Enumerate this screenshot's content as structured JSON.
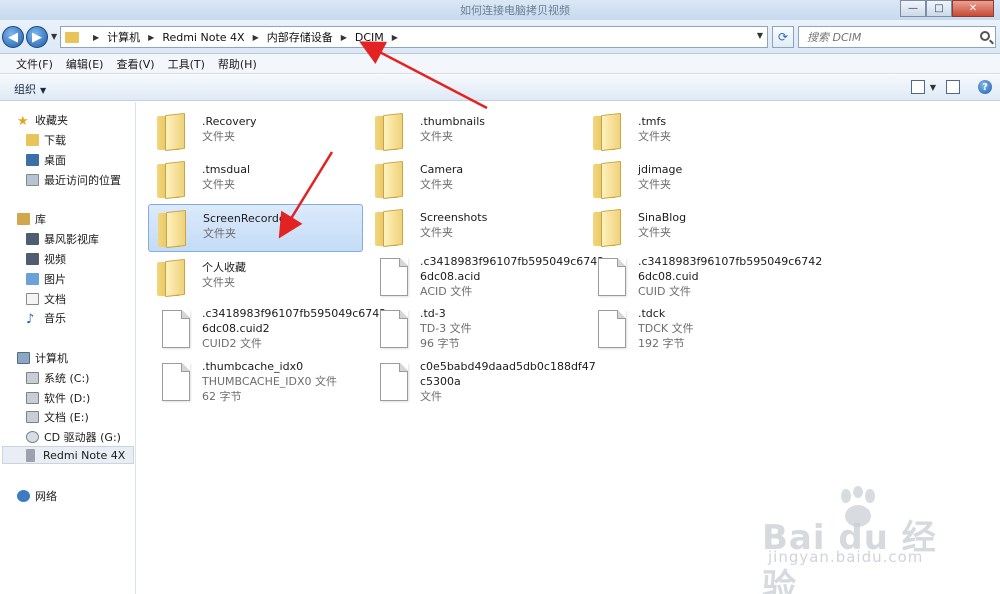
{
  "window": {
    "title": "如何连接电脑拷贝视频",
    "buttons": {
      "minimize": "—",
      "maximize": "□",
      "close": "✕"
    }
  },
  "address": {
    "crumbs": [
      "计算机",
      "Redmi Note 4X",
      "内部存储设备",
      "DCIM"
    ],
    "search_placeholder": "搜索 DCIM"
  },
  "menu": [
    "文件(F)",
    "编辑(E)",
    "查看(V)",
    "工具(T)",
    "帮助(H)"
  ],
  "toolbar": {
    "organize": "组织"
  },
  "sidebar": {
    "favorites": {
      "label": "收藏夹",
      "items": [
        "下载",
        "桌面",
        "最近访问的位置"
      ]
    },
    "libraries": {
      "label": "库",
      "items": [
        "暴风影视库",
        "视频",
        "图片",
        "文档",
        "音乐"
      ]
    },
    "computer": {
      "label": "计算机",
      "items": [
        "系统 (C:)",
        "软件 (D:)",
        "文档 (E:)",
        "CD 驱动器 (G:)",
        "Redmi Note 4X"
      ],
      "selected": "Redmi Note 4X"
    },
    "network": {
      "label": "网络"
    }
  },
  "files": [
    {
      "name": ".Recovery",
      "type": "文件夹",
      "kind": "folder"
    },
    {
      "name": ".thumbnails",
      "type": "文件夹",
      "kind": "folder"
    },
    {
      "name": ".tmfs",
      "type": "文件夹",
      "kind": "folder"
    },
    {
      "name": ".tmsdual",
      "type": "文件夹",
      "kind": "folder"
    },
    {
      "name": "Camera",
      "type": "文件夹",
      "kind": "folder"
    },
    {
      "name": "jdimage",
      "type": "文件夹",
      "kind": "folder"
    },
    {
      "name": "ScreenRecorder",
      "type": "文件夹",
      "kind": "folder",
      "selected": true
    },
    {
      "name": "Screenshots",
      "type": "文件夹",
      "kind": "folder"
    },
    {
      "name": "SinaBlog",
      "type": "文件夹",
      "kind": "folder"
    },
    {
      "name": "个人收藏",
      "type": "文件夹",
      "kind": "folder"
    },
    {
      "name": ".c3418983f96107fb595049c6742\n6dc08.acid",
      "type": "ACID 文件",
      "kind": "file"
    },
    {
      "name": ".c3418983f96107fb595049c6742\n6dc08.cuid",
      "type": "CUID 文件",
      "kind": "file"
    },
    {
      "name": ".c3418983f96107fb595049c6742\n6dc08.cuid2",
      "type": "CUID2 文件",
      "kind": "file"
    },
    {
      "name": ".td-3",
      "type": "TD-3 文件",
      "size": "96 字节",
      "kind": "file"
    },
    {
      "name": ".tdck",
      "type": "TDCK 文件",
      "size": "192 字节",
      "kind": "file"
    },
    {
      "name": ".thumbcache_idx0",
      "type": "THUMBCACHE_IDX0 文件",
      "size": "62 字节",
      "kind": "file"
    },
    {
      "name": "c0e5babd49daad5db0c188df47\nc5300a",
      "type": "文件",
      "kind": "file"
    }
  ],
  "watermark": {
    "brand": "Bai du 经验",
    "url": "jingyan.baidu.com"
  },
  "colors": {
    "arrow": "#e32222",
    "selection": "#c4dcf6",
    "folder": "#e8c45a"
  }
}
